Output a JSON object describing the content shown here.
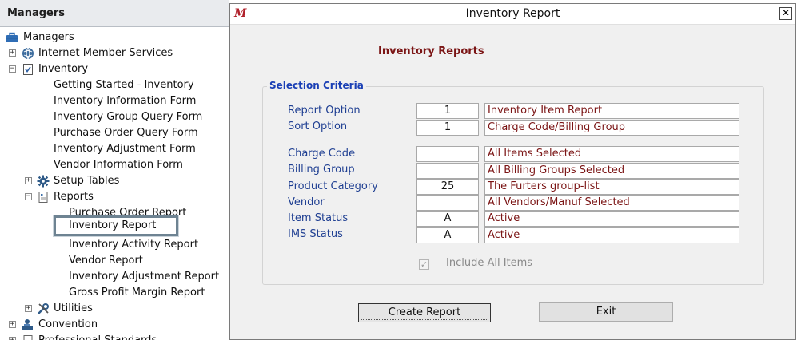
{
  "left_panel": {
    "title": "Managers",
    "tree": [
      {
        "label": "Managers",
        "icon": "briefcase-icon"
      },
      {
        "label": "Internet Member Services",
        "icon": "globe-icon",
        "expander": "+"
      },
      {
        "label": "Inventory",
        "icon": "checklist-icon",
        "expander": "−"
      },
      {
        "label": "Getting Started - Inventory"
      },
      {
        "label": "Inventory Information Form"
      },
      {
        "label": "Inventory Group Query Form"
      },
      {
        "label": "Purchase Order Query Form"
      },
      {
        "label": "Inventory Adjustment Form"
      },
      {
        "label": "Vendor Information Form"
      },
      {
        "label": "Setup Tables",
        "icon": "gear-icon",
        "expander": "+"
      },
      {
        "label": "Reports",
        "icon": "report-icon",
        "expander": "−"
      },
      {
        "label": "Purchase Order Report"
      },
      {
        "label": "Inventory Report",
        "selected": true
      },
      {
        "label": "Inventory Activity Report"
      },
      {
        "label": "Vendor Report"
      },
      {
        "label": "Inventory Adjustment Report"
      },
      {
        "label": "Gross Profit Margin Report"
      },
      {
        "label": "Utilities",
        "icon": "tools-icon",
        "expander": "+"
      },
      {
        "label": "Convention",
        "icon": "speaker-icon",
        "expander": "+"
      },
      {
        "label": "Professional Standards",
        "icon": "document-icon",
        "expander": "+"
      }
    ]
  },
  "dialog": {
    "logo": "M",
    "title": "Inventory Report",
    "close_symbol": "✕",
    "heading": "Inventory Reports",
    "group_title": "Selection Criteria",
    "rows": [
      {
        "label": "Report Option",
        "code": "1",
        "description": "Inventory Item Report"
      },
      {
        "label": "Sort Option",
        "code": "1",
        "description": "Charge Code/Billing Group"
      },
      {
        "label": "Charge Code",
        "code": "",
        "description": "All Items Selected"
      },
      {
        "label": "Billing Group",
        "code": "",
        "description": "All Billing Groups Selected"
      },
      {
        "label": "Product Category",
        "code": "25",
        "description": "The Furters group-list"
      },
      {
        "label": "Vendor",
        "code": "",
        "description": "All Vendors/Manuf Selected"
      },
      {
        "label": "Item Status",
        "code": "A",
        "description": "Active"
      },
      {
        "label": "IMS Status",
        "code": "A",
        "description": "Active"
      }
    ],
    "include_all_label": "Include All Items",
    "include_all_checked": true,
    "create_button": "Create Report",
    "exit_button": "Exit"
  },
  "colors": {
    "label_blue": "#1f3f92",
    "value_red": "#7b1515",
    "legend_blue": "#1a3fb5",
    "logo_red": "#b0202a"
  }
}
